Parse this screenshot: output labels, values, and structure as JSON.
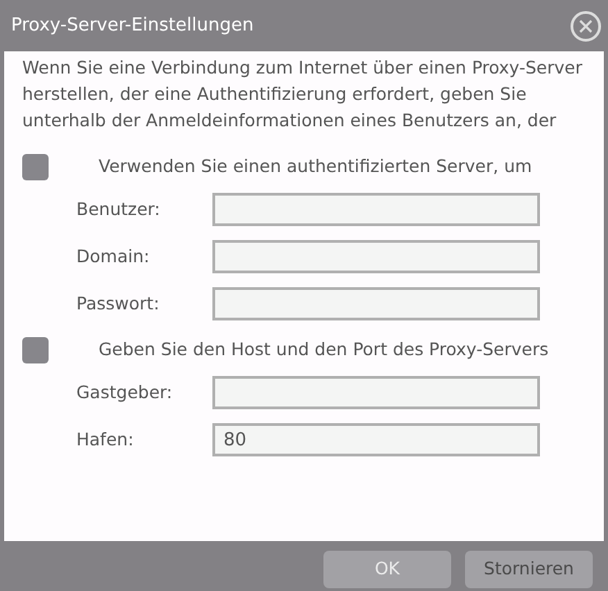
{
  "window": {
    "title": "Proxy-Server-Einstellungen"
  },
  "intro": "Wenn Sie eine Verbindung zum Internet über einen Proxy-Server herstellen, der eine Authentifizierung erfordert, geben Sie unterhalb der Anmeldeinformationen eines Benutzers an, der",
  "sections": [
    {
      "label": "Verwenden Sie einen authentifizierten Server, um",
      "checked": false,
      "fields": [
        {
          "label": "Benutzer:"
        },
        {
          "label": "Domain:"
        },
        {
          "label": "Passwort:"
        }
      ]
    },
    {
      "label": "Geben Sie den Host und den Port des Proxy-Servers",
      "checked": false,
      "fields": [
        {
          "label": "Gastgeber:"
        },
        {
          "label": "Hafen:",
          "value": "80"
        }
      ]
    }
  ],
  "buttons": [
    {
      "label": "OK",
      "disabled": true
    },
    {
      "label": "Stornieren",
      "disabled": false
    }
  ]
}
